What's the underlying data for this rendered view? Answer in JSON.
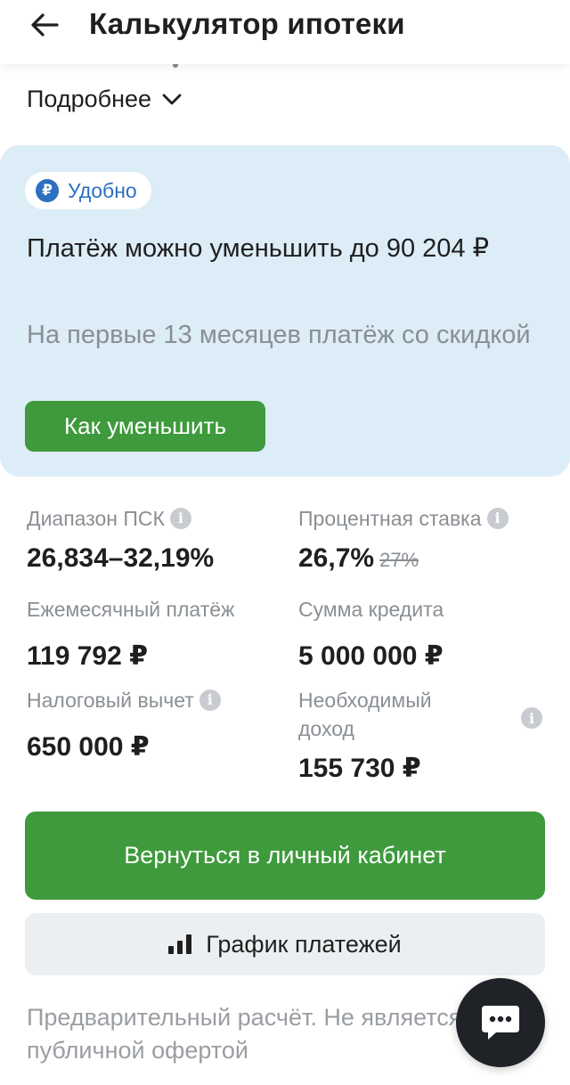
{
  "header": {
    "title": "Калькулятор ипотеки"
  },
  "details": {
    "label": "Подробнее"
  },
  "promo": {
    "badge": "Удобно",
    "badge_symbol": "₽",
    "title": "Платёж можно уменьшить до 90 204 ₽",
    "subtitle": "На первые 13 месяцев платёж со скидкой",
    "button": "Как уменьшить"
  },
  "info": {
    "psk": {
      "label": "Диапазон ПСК",
      "value": "26,834–32,19%"
    },
    "rate": {
      "label": "Процентная ставка",
      "value": "26,7%",
      "old_value": "27%"
    },
    "monthly": {
      "label": "Ежемесячный платёж",
      "value": "119 792 ₽"
    },
    "loan": {
      "label": "Сумма кредита",
      "value": "5 000 000 ₽"
    },
    "tax": {
      "label": "Налоговый вычет",
      "value": "650 000 ₽"
    },
    "income": {
      "label_line1": "Необходимый",
      "label_line2": "доход",
      "value": "155 730 ₽"
    }
  },
  "buttons": {
    "back_to_cabinet": "Вернуться в личный кабинет",
    "schedule": "График платежей"
  },
  "disclaimer": "Предварительный расчёт. Не является публичной офертой",
  "colors": {
    "accent_green": "#3e9a3c",
    "promo_bg": "#dcedf8",
    "badge_blue": "#2e6fc0"
  }
}
